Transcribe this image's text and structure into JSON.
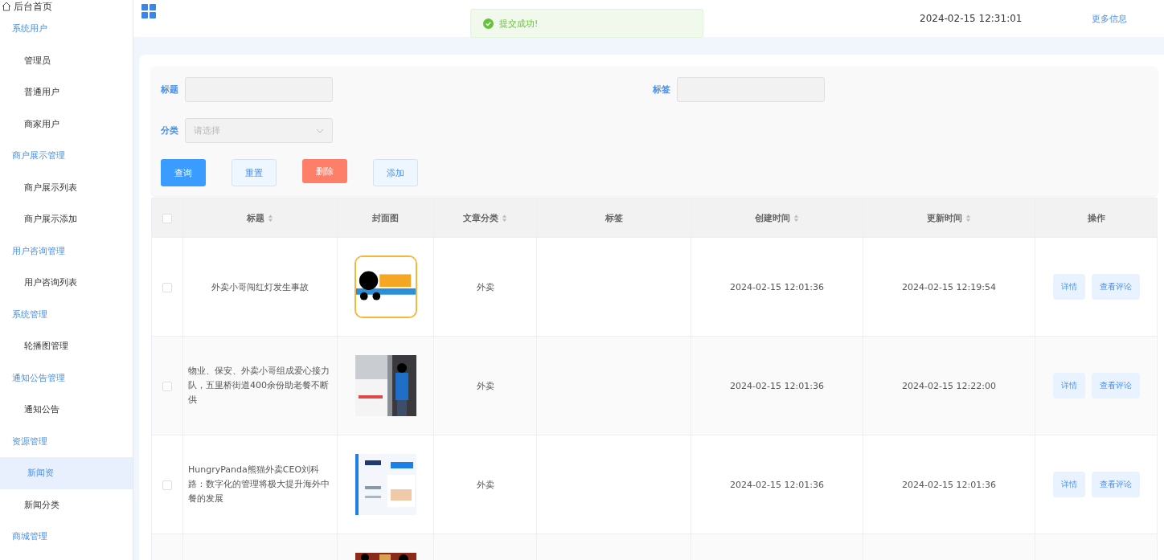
{
  "sidebar": {
    "home": "后台首页",
    "groups": [
      {
        "label": "系统用户",
        "children": [
          {
            "label": "管理员",
            "selected": false
          },
          {
            "label": "普通用户",
            "selected": false
          },
          {
            "label": "商家用户",
            "selected": false
          }
        ]
      },
      {
        "label": "商户展示管理",
        "children": [
          {
            "label": "商户展示列表",
            "selected": false
          },
          {
            "label": "商户展示添加",
            "selected": false
          }
        ]
      },
      {
        "label": "用户咨询管理",
        "children": [
          {
            "label": "用户咨询列表",
            "selected": false
          }
        ]
      },
      {
        "label": "系统管理",
        "children": [
          {
            "label": "轮播图管理",
            "selected": false
          }
        ]
      },
      {
        "label": "通知公告管理",
        "children": [
          {
            "label": "通知公告",
            "selected": false
          }
        ]
      },
      {
        "label": "资源管理",
        "children": [
          {
            "label": "新闻资",
            "selected": true
          },
          {
            "label": "新闻分类",
            "selected": false
          }
        ]
      },
      {
        "label": "商城管理"
      }
    ]
  },
  "header": {
    "datetime": "2024-02-15 12:31:01",
    "more": "更多信息"
  },
  "toast": {
    "message": "提交成功!"
  },
  "filters": {
    "title_label": "标题",
    "tag_label": "标签",
    "category_label": "分类",
    "category_placeholder": "请选择"
  },
  "buttons": [
    {
      "label": "查询",
      "kind": "primary"
    },
    {
      "label": "重置",
      "kind": "plain"
    },
    {
      "label": "删除",
      "kind": "danger"
    },
    {
      "label": "添加",
      "kind": "plain"
    }
  ],
  "table": {
    "select_all_checked": false,
    "columns": [
      {
        "label": "标题",
        "sortable": true
      },
      {
        "label": "封面图",
        "sortable": false
      },
      {
        "label": "文章分类",
        "sortable": true
      },
      {
        "label": "标签",
        "sortable": false
      },
      {
        "label": "创建时间",
        "sortable": true
      },
      {
        "label": "更新时间",
        "sortable": true
      },
      {
        "label": "操作",
        "sortable": false
      }
    ],
    "rows": [
      {
        "title": "外卖小哥闯红灯发生事故",
        "bordered": true,
        "category": "外卖",
        "created": "2024-02-15 12:01:36",
        "updated": "2024-02-15 12:19:54",
        "actions": [
          "详情",
          "查看评论"
        ],
        "checked": false
      },
      {
        "title": "物业、保安、外卖小哥组成爱心接力队，五里桥街道400余份助老餐不断供",
        "bordered": false,
        "category": "外卖",
        "created": "2024-02-15 12:01:36",
        "updated": "2024-02-15 12:22:00",
        "actions": [
          "详情",
          "查看评论"
        ],
        "checked": false
      },
      {
        "title": "HungryPanda熊猫外卖CEO刘科路：数字化的管理将极大提升海外中餐的发展",
        "bordered": false,
        "category": "外卖",
        "created": "2024-02-15 12:01:36",
        "updated": "2024-02-15 12:01:36",
        "actions": [
          "详情",
          "查看评论"
        ],
        "checked": false
      },
      {
        "bordered": false
      }
    ]
  }
}
